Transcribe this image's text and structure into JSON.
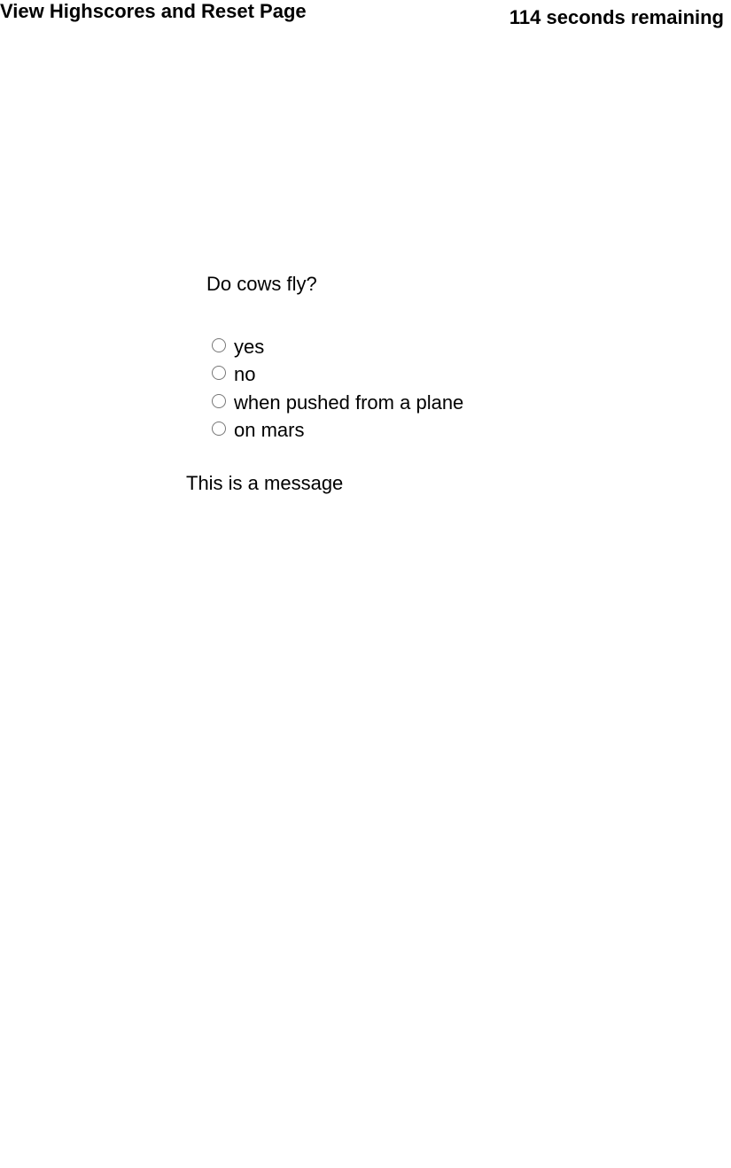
{
  "header": {
    "highscores_link": "View Highscores and Reset Page",
    "timer": "114 seconds remaining"
  },
  "quiz": {
    "question": "Do cows fly?",
    "options": [
      {
        "label": "yes",
        "selected": false
      },
      {
        "label": "no",
        "selected": false
      },
      {
        "label": "when pushed from a plane",
        "selected": false
      },
      {
        "label": "on mars",
        "selected": false
      }
    ],
    "message": "This is a message"
  },
  "colors": {
    "text": "#000000",
    "background": "#ffffff",
    "radio_border": "#767676"
  }
}
